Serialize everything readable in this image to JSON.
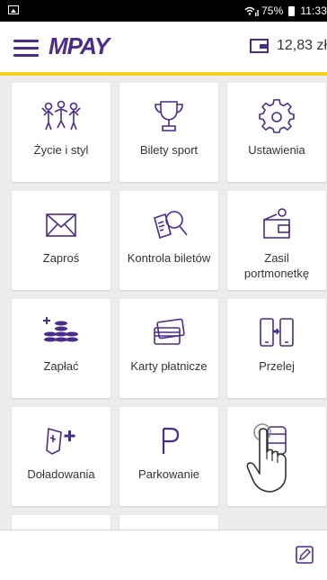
{
  "status_bar": {
    "signal_text": "75%",
    "time": "11:33"
  },
  "header": {
    "logo": "MPAY",
    "balance": "12,83 zł"
  },
  "tiles": [
    {
      "label": "Życie i styl",
      "icon": "people-icon"
    },
    {
      "label": "Bilety sport",
      "icon": "trophy-icon"
    },
    {
      "label": "Ustawienia",
      "icon": "gear-icon"
    },
    {
      "label": "Zaproś",
      "icon": "envelope-icon"
    },
    {
      "label": "Kontrola biletów",
      "icon": "ticket-magnifier-icon"
    },
    {
      "label": "Zasil portmonetkę",
      "icon": "wallet-plus-icon"
    },
    {
      "label": "Zapłać",
      "icon": "coins-icon"
    },
    {
      "label": "Karty płatnicze",
      "icon": "cards-icon"
    },
    {
      "label": "Przelej",
      "icon": "transfer-icon"
    },
    {
      "label": "Doładowania",
      "icon": "gamepad-plus-icon"
    },
    {
      "label": "Parkowanie",
      "icon": "parking-icon"
    },
    {
      "label": "",
      "icon": "bus-icon"
    }
  ],
  "colors": {
    "brand_purple": "#4b2b8c",
    "accent_yellow": "#f5d01d"
  }
}
